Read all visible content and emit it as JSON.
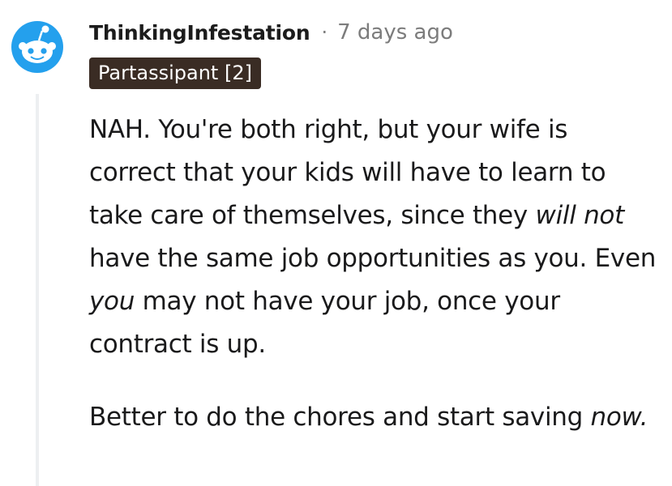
{
  "comment": {
    "username": "ThinkingInfestation",
    "separator": "·",
    "timestamp": "7 days ago",
    "flair": "Partassipant [2]",
    "avatar_icon": "snoo-avatar-icon",
    "paragraph1": {
      "t1": "NAH. You're both right, but your wife is correct that your kids will have to learn to take care of themselves, since they ",
      "em1": "will not",
      "t2": " have the same job opportunities as you. Even ",
      "em2": "you",
      "t3": " may not have your job, once your contract is up."
    },
    "paragraph2": {
      "t1": "Better to do the chores and start saving ",
      "em1": "now."
    }
  },
  "colors": {
    "avatar_bg": "#24A0ED",
    "flair_bg": "#3A2C24",
    "thread_line": "#EDEFF1",
    "meta_text": "#7C7C7C"
  }
}
